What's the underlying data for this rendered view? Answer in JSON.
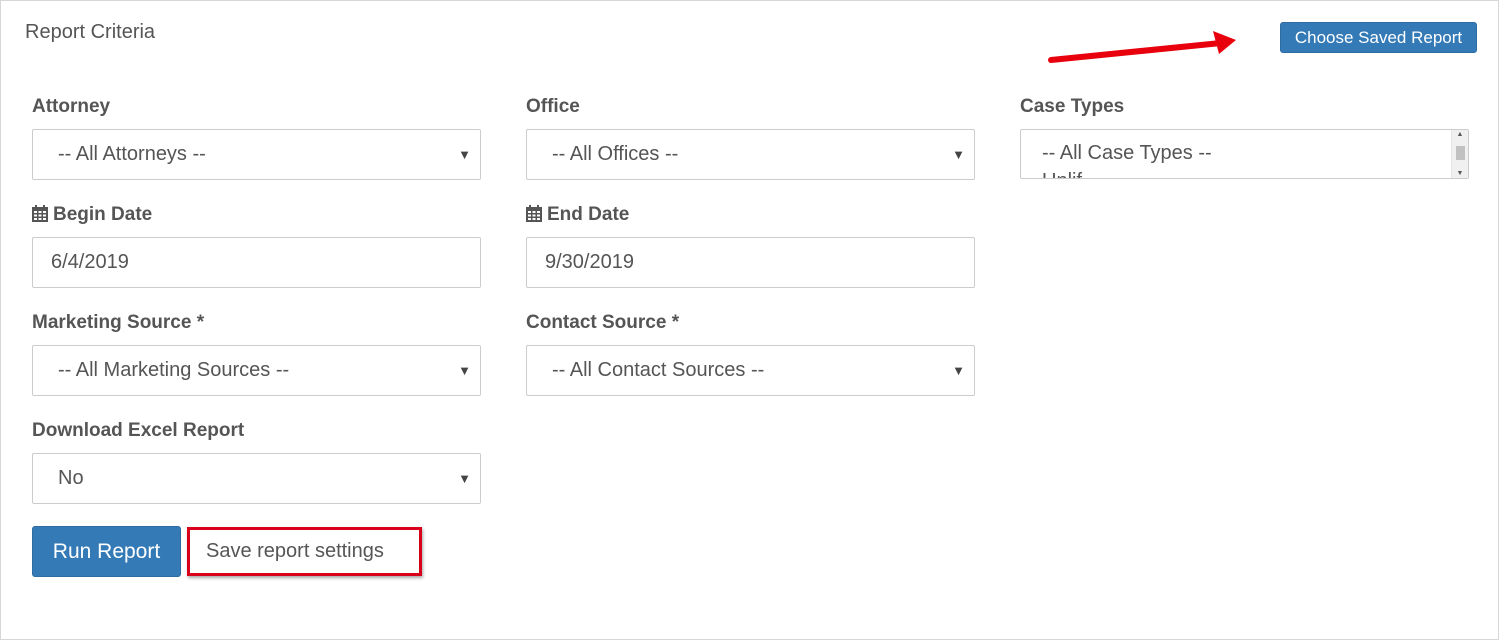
{
  "panel": {
    "title": "Report Criteria"
  },
  "saved_report_button": "Choose Saved Report",
  "attorney": {
    "label": "Attorney",
    "value": "-- All Attorneys --"
  },
  "office": {
    "label": "Office",
    "value": "-- All Offices --"
  },
  "case_types": {
    "label": "Case Types",
    "options": [
      "-- All Case Types --",
      "Unlif"
    ]
  },
  "begin_date": {
    "label": "Begin Date",
    "value": "6/4/2019"
  },
  "end_date": {
    "label": "End Date",
    "value": "9/30/2019"
  },
  "marketing_source": {
    "label": "Marketing Source *",
    "value": "-- All Marketing Sources --"
  },
  "contact_source": {
    "label": "Contact Source *",
    "value": "-- All Contact Sources --"
  },
  "download_excel": {
    "label": "Download Excel Report",
    "value": "No"
  },
  "buttons": {
    "run_report": "Run Report",
    "save_settings": "Save report settings"
  },
  "colors": {
    "primary": "#337ab7",
    "annotation_red": "#d9001b",
    "label_text": "#555555"
  },
  "icons": {
    "calendar": "calendar-icon",
    "caret": "caret-down-icon"
  }
}
